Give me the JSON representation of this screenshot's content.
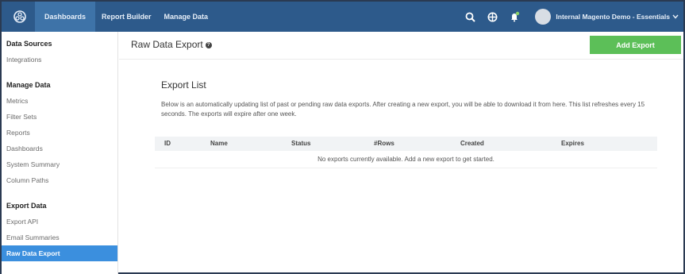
{
  "topbar": {
    "nav": [
      "Dashboards",
      "Report Builder",
      "Manage Data"
    ],
    "account": "Internal Magento Demo - Essentials",
    "icons": [
      "logo-icon",
      "search-icon",
      "globe-icon",
      "notification-icon",
      "avatar"
    ]
  },
  "sidebar": {
    "sections": [
      {
        "heading": "Data Sources",
        "items": [
          "Integrations"
        ]
      },
      {
        "heading": "Manage Data",
        "items": [
          "Metrics",
          "Filter Sets",
          "Reports",
          "Dashboards",
          "System Summary",
          "Column Paths"
        ]
      },
      {
        "heading": "Export Data",
        "items": [
          "Export API",
          "Email Summaries",
          "Raw Data Export"
        ]
      }
    ],
    "active_item": "Raw Data Export"
  },
  "main": {
    "page_title": "Raw Data Export",
    "add_button": "Add Export",
    "section_title": "Export List",
    "description": "Below is an automatically updating list of past or pending raw data exports. After creating a new export, you will be able to download it from here. This list refreshes every 15 seconds. The exports will expire after one week.",
    "table": {
      "columns": [
        "ID",
        "Name",
        "Status",
        "#Rows",
        "Created",
        "Expires"
      ],
      "empty_message": "No exports currently available. Add a new export to get started."
    }
  },
  "colors": {
    "topbar": "#2d5a8b",
    "active_nav": "#3e73a8",
    "active_sidebar": "#3b8fde",
    "primary_button": "#5cbf58"
  }
}
